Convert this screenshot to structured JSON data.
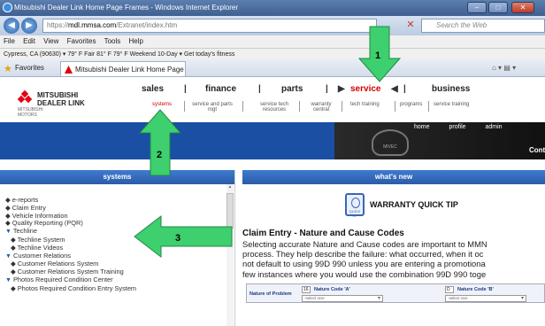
{
  "window": {
    "title": "Mitsubishi Dealer Link Home Page Frames - Windows Internet Explorer",
    "buttons": [
      "–",
      "□",
      "✕"
    ]
  },
  "addressbar": {
    "url_prefix": "https://",
    "url_host": "mdl.mmsa.com",
    "url_path": "/Extranet/index.htm",
    "search_placeholder": "Search the Web"
  },
  "menubar": [
    "File",
    "Edit",
    "View",
    "Favorites",
    "Tools",
    "Help"
  ],
  "weatherbar": {
    "text": "Cypress, CA (90630)  ▾  79° F Fair   81° F   79° F  Weekend  10-Day  ▾  Get today's fitness"
  },
  "favorites": {
    "label": "Favorites",
    "tab": "Mitsubishi Dealer Link Home Page Fra..."
  },
  "logo": {
    "line1": "MITSUBISHI",
    "line2": "DEALER LINK",
    "sub": "MITSUBISHI MOTORS"
  },
  "topnav": {
    "items": [
      "sales",
      "finance",
      "parts",
      "service",
      "business"
    ],
    "active": "service"
  },
  "subnav": {
    "items": [
      "systems",
      "service and parts mgt",
      "service tech resources",
      "warranty central",
      "tech training",
      "programs",
      "service training"
    ],
    "active": "systems"
  },
  "banner": {
    "links": [
      "home",
      "profile",
      "admin"
    ],
    "cont": "Cont",
    "emblem": "MIVEC"
  },
  "left_panel": {
    "title": "systems",
    "items": [
      {
        "label": "e-reports",
        "level": 0,
        "marker": "◆"
      },
      {
        "label": "Claim Entry",
        "level": 0,
        "marker": "◆"
      },
      {
        "label": "Vehicle Information",
        "level": 0,
        "marker": "◆"
      },
      {
        "label": "Quality Reporting (PQR)",
        "level": 0,
        "marker": "◆"
      },
      {
        "label": "Techline",
        "level": 0,
        "marker": "▼"
      },
      {
        "label": "Techline System",
        "level": 1,
        "marker": "◆"
      },
      {
        "label": "Techline Videos",
        "level": 1,
        "marker": "◆"
      },
      {
        "label": "Customer Relations",
        "level": 0,
        "marker": "▼"
      },
      {
        "label": "Customer Relations System",
        "level": 1,
        "marker": "◆"
      },
      {
        "label": "Customer Relations System Training",
        "level": 1,
        "marker": "◆"
      },
      {
        "label": "Photos Required Condition Center",
        "level": 0,
        "marker": "▼"
      },
      {
        "label": "Photos Required Condition Entry System",
        "level": 1,
        "marker": "◆"
      }
    ]
  },
  "right_panel": {
    "title": "what's new",
    "tip_icon": "QUICK TIP",
    "tip_title": "WARRANTY QUICK TIP",
    "claim_title": "Claim Entry - Nature and Cause Codes",
    "claim_lines": [
      "Selecting accurate Nature and Cause codes are important to MMN",
      "process. They help describe the failure: what occurred, when it oc",
      "not default to using 99D 990 unless you are entering a promotiona",
      "few instances where you would use the combination 99D 990 toge"
    ],
    "form": {
      "row_label": "Nature of Problem",
      "code_a_box": "16",
      "code_a_label": "Nature Code 'A'",
      "code_b_box": "D",
      "code_b_label": "Nature Code 'B'",
      "select_a": "-select one-",
      "select_b": "-select one-"
    }
  },
  "annotations": {
    "arrow1_label": "1",
    "arrow2_label": "2",
    "arrow3_label": "3",
    "color": "#3ecf6f"
  }
}
